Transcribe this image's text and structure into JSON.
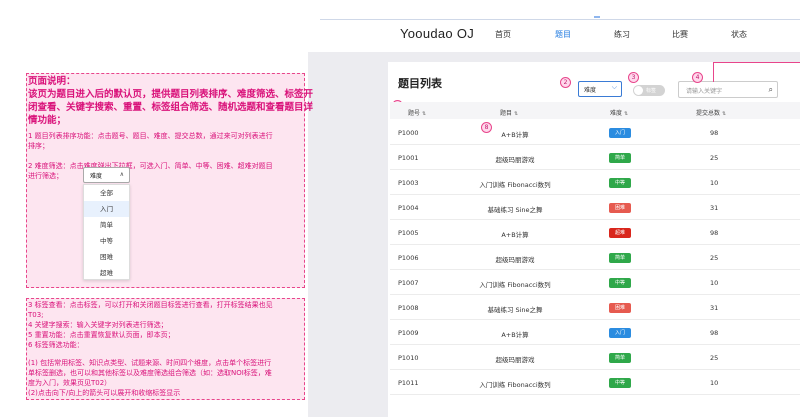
{
  "header": {
    "brand": "Yooudao OJ",
    "nav": [
      "首页",
      "题目",
      "练习",
      "比赛",
      "状态"
    ],
    "active_nav": "题目"
  },
  "panel": {
    "title": "题目列表",
    "difficulty_select": "难度",
    "tag_toggle_label": "标签",
    "search_placeholder": "请输入关键字",
    "columns": [
      "题号",
      "题目",
      "难度",
      "提交总数"
    ]
  },
  "badges": [
    "1",
    "2",
    "3",
    "4",
    "8"
  ],
  "rows": [
    {
      "id": "P1000",
      "title": "A+B计算",
      "level": "入门",
      "submits": "98"
    },
    {
      "id": "P1001",
      "title": "超级玛丽游戏",
      "level": "简单",
      "submits": "25"
    },
    {
      "id": "P1003",
      "title": "入门训练 Fibonacci数列",
      "level": "中等",
      "submits": "10"
    },
    {
      "id": "P1004",
      "title": "基础练习 Sine之舞",
      "level": "困难",
      "submits": "31"
    },
    {
      "id": "P1005",
      "title": "A+B计算",
      "level": "超难",
      "submits": "98"
    },
    {
      "id": "P1006",
      "title": "超级玛丽游戏",
      "level": "简单",
      "submits": "25"
    },
    {
      "id": "P1007",
      "title": "入门训练 Fibonacci数列",
      "level": "中等",
      "submits": "10"
    },
    {
      "id": "P1008",
      "title": "基础练习 Sine之舞",
      "level": "困难",
      "submits": "31"
    },
    {
      "id": "P1009",
      "title": "A+B计算",
      "level": "入门",
      "submits": "98"
    },
    {
      "id": "P1010",
      "title": "超级玛丽游戏",
      "level": "简单",
      "submits": "25"
    },
    {
      "id": "P1011",
      "title": "入门训练 Fibonacci数列",
      "level": "中等",
      "submits": "10"
    }
  ],
  "level_colors": {
    "入门": "#2b8ce0",
    "简单": "#2fa84a",
    "中等": "#2fa84a",
    "困难": "#e65a4f",
    "超难": "#d9261c"
  },
  "notes": {
    "heading_lines": [
      "页面说明：",
      "该页为题目进入后的默认页，提供题目列表排序、难度筛选、标签开",
      "闭查看、关键字搜索、重置、标签组合筛选、随机选题和查看题目详",
      "情功能；"
    ],
    "item1_lines": [
      "1 题目列表排序功能：点击题号、题目、难度、提交总数，通过来可对列表进行",
      "排序；"
    ],
    "item2_lines": [
      "2 难度筛选：点击难度弹出下拉框，可选入门、简单、中等、困难、超难对题目",
      "进行筛选；"
    ],
    "dropdown_trigger": "难度",
    "dropdown_options": [
      "全部",
      "入门",
      "简单",
      "中等",
      "困难",
      "超难"
    ],
    "dropdown_highlight": 1,
    "note2_lines": [
      "3 标签查看：点击标签，可以打开和关闭题目标签进行查看，打开标签结果也见",
      "T03;",
      "4 关键字搜索：输入关键字对列表进行筛选；",
      "5 重置功能：点击重置恢复默认页面，即本页；",
      "6 标签筛选功能：",
      "",
      "(1) 包括常用标签、知识点类型、试题来源、时间四个维度，点击单个标签进行",
      "单标签删选，也可以和其他标签以及难度筛选组合筛选（如：选取NOI标签，难",
      "度为入门，效果页见T02）",
      "(2)点击向下/向上的箭头可以展开和收缩标签显示"
    ]
  }
}
